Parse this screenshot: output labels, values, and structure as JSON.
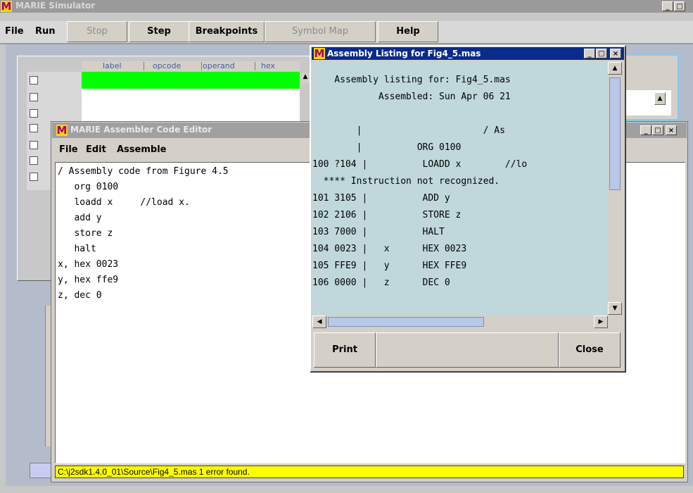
{
  "main_window": {
    "title": "MARIE Simulator",
    "menu": {
      "file": "File",
      "run": "Run",
      "stop": "Stop",
      "step": "Step",
      "breakpoints": "Breakpoints",
      "symbol_map": "Symbol Map",
      "help": "Help"
    },
    "table_headers": [
      "label",
      "opcode",
      "operand",
      "hex"
    ]
  },
  "editor": {
    "title": "MARIE Assembler Code Editor",
    "menu": {
      "file": "File",
      "edit": "Edit",
      "assemble": "Assemble"
    },
    "code_lines": [
      "/ Assembly code from Figure 4.5",
      "   org 0100",
      "   loadd x     //load x.",
      "   add y",
      "   store z",
      "   halt",
      "x, hex 0023",
      "y, hex ffe9",
      "z, dec 0"
    ],
    "status": "C:\\j2sdk1.4.0_01\\Source\\Fig4_5.mas 1 error found."
  },
  "listing": {
    "title": "Assembly Listing for Fig4_5.mas",
    "lines": [
      "    Assembly listing for: Fig4_5.mas",
      "            Assembled: Sun Apr 06 21",
      "",
      "        |                      / As",
      "        |          ORG 0100",
      "100 ?104 |          LOADD x        //lo",
      "  **** Instruction not recognized.",
      "101 3105 |          ADD y",
      "102 2106 |          STORE z",
      "103 7000 |          HALT",
      "104 0023 |   x      HEX 0023",
      "105 FFE9 |   y      HEX FFE9",
      "106 0000 |   z      DEC 0"
    ],
    "print": "Print",
    "close": "Close"
  },
  "colors": {
    "listing_bg": "#c0d8dc",
    "status_bg": "#ffff00",
    "highlight_row": "#00ff00",
    "active_title": "#0a2b8a",
    "inactive_title": "#9a9a9a"
  }
}
